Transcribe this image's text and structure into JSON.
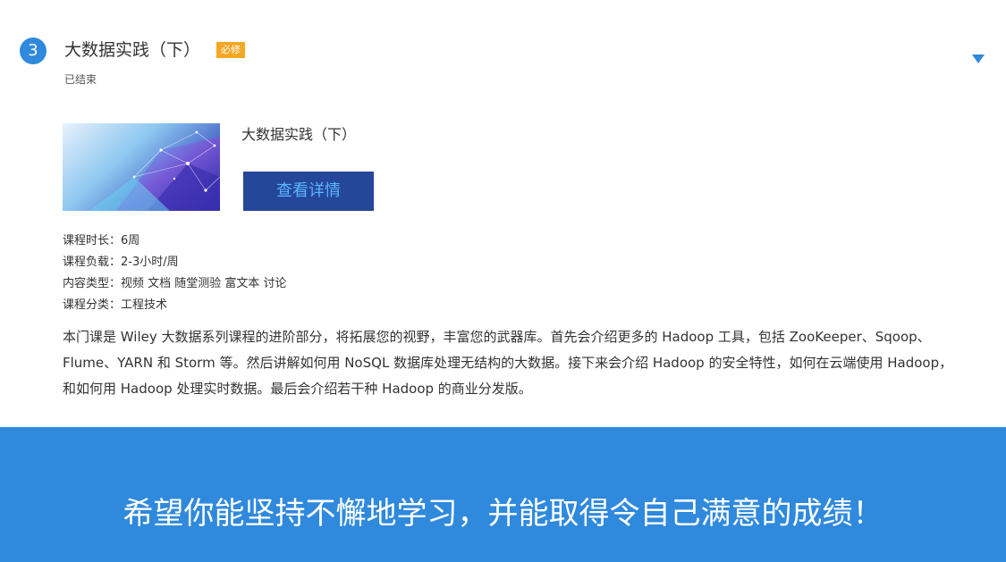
{
  "course": {
    "step_number": "3",
    "title": "大数据实践（下）",
    "required_tag": "必修",
    "status": "已结束",
    "toggle_icon": "triangle-down-icon",
    "thumbnail_icon": "network-abstract-image",
    "detail_title": "大数据实践（下）",
    "detail_button_label": "查看详情",
    "meta": {
      "duration": "课程时长：6周",
      "workload": "课程负载：2-3小时/周",
      "content_types": "内容类型：视频 文档 随堂测验 富文本 讨论",
      "category": "课程分类：工程技术"
    },
    "description": "本门课是 Wiley 大数据系列课程的进阶部分，将拓展您的视野，丰富您的武器库。首先会介绍更多的 Hadoop 工具，包括 ZooKeeper、Sqoop、Flume、YARN 和 Storm 等。然后讲解如何用 NoSQL 数据库处理无结构的大数据。接下来会介绍 Hadoop 的安全特性，如何在云端使用 Hadoop，和如何用 Hadoop 处理实时数据。最后会介绍若干种 Hadoop 的商业分发版。"
  },
  "footer": {
    "message": "希望你能坚持不懈地学习，并能取得令自己满意的成绩！"
  },
  "colors": {
    "accent_blue": "#2f89dc",
    "button_navy": "#25479a",
    "button_text": "#5bb4ff",
    "required_orange": "#f5a623"
  }
}
